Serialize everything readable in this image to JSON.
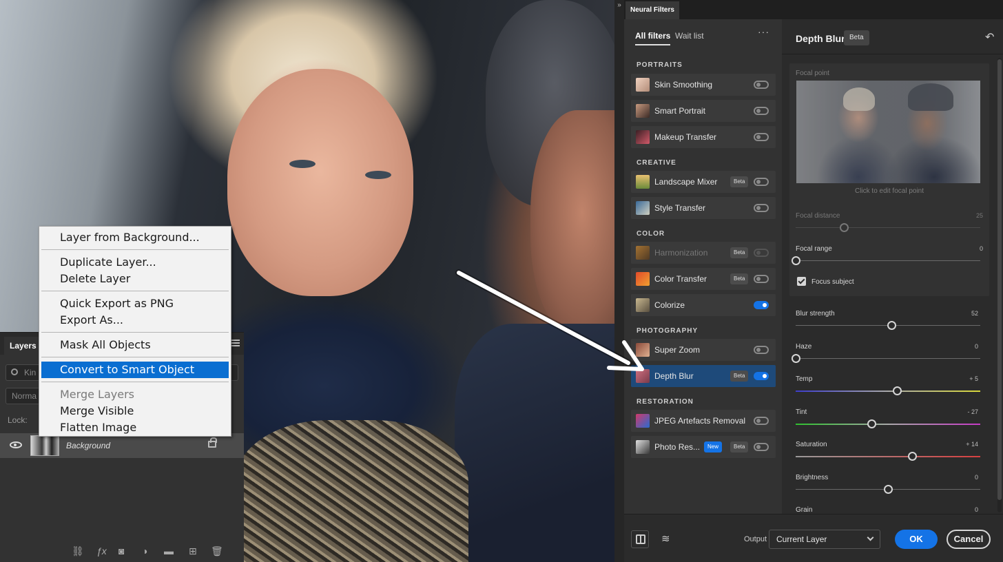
{
  "layers_panel": {
    "tab": "Layers",
    "search_placeholder": "Kin",
    "blend_mode": "Norma",
    "lock_label": "Lock:",
    "layer_name": "Background"
  },
  "context_menu": {
    "items": [
      {
        "label": "Layer from Background..."
      },
      {
        "label": "Duplicate Layer..."
      },
      {
        "label": "Delete Layer"
      },
      {
        "label": "Quick Export as PNG"
      },
      {
        "label": "Export As..."
      },
      {
        "label": "Mask All Objects"
      },
      {
        "label": "Convert to Smart Object",
        "selected": true
      },
      {
        "label": "Merge Layers",
        "disabled": true
      },
      {
        "label": "Merge Visible"
      },
      {
        "label": "Flatten Image"
      }
    ]
  },
  "neural_filters": {
    "dialog_tab": "Neural Filters",
    "list_tabs": {
      "all": "All filters",
      "wait": "Wait list"
    },
    "more": "···",
    "categories": [
      "PORTRAITS",
      "CREATIVE",
      "COLOR",
      "PHOTOGRAPHY",
      "RESTORATION"
    ],
    "filters": [
      {
        "name": "Skin Smoothing",
        "on": false
      },
      {
        "name": "Smart Portrait",
        "on": false
      },
      {
        "name": "Makeup Transfer",
        "on": false
      },
      {
        "name": "Landscape Mixer",
        "badge": "Beta",
        "on": false
      },
      {
        "name": "Style Transfer",
        "on": false
      },
      {
        "name": "Harmonization",
        "badge": "Beta",
        "on": false,
        "disabled": true
      },
      {
        "name": "Color Transfer",
        "badge": "Beta",
        "on": false
      },
      {
        "name": "Colorize",
        "on": true
      },
      {
        "name": "Super Zoom",
        "on": false
      },
      {
        "name": "Depth Blur",
        "badge": "Beta",
        "on": true,
        "active": true
      },
      {
        "name": "JPEG Artefacts Removal",
        "on": false
      },
      {
        "name": "Photo Res...",
        "badge_new": "New",
        "badge": "Beta",
        "on": false
      }
    ],
    "detail": {
      "title": "Depth Blur",
      "badge": "Beta",
      "focal_point_label": "Focal point",
      "preview_caption": "Click to edit focal point",
      "focal_distance": {
        "label": "Focal distance",
        "value": "25",
        "level": 0.26
      },
      "focal_range": {
        "label": "Focal range",
        "value": "0",
        "level": 0.0
      },
      "focus_subject": "Focus subject",
      "sliders": [
        {
          "label": "Blur strength",
          "value": "52",
          "level": 0.52,
          "kind": "plain"
        },
        {
          "label": "Haze",
          "value": "0",
          "level": 0.0,
          "kind": "plain"
        },
        {
          "label": "Temp",
          "value": "+ 5",
          "level": 0.55,
          "kind": "temp"
        },
        {
          "label": "Tint",
          "value": "- 27",
          "level": 0.41,
          "kind": "tint"
        },
        {
          "label": "Saturation",
          "value": "+ 14",
          "level": 0.63,
          "kind": "sat"
        },
        {
          "label": "Brightness",
          "value": "0",
          "level": 0.5,
          "kind": "plain"
        },
        {
          "label": "Grain",
          "value": "0",
          "level": 0.0,
          "kind": "plain"
        }
      ]
    },
    "footer": {
      "output_label": "Output",
      "output_value": "Current Layer",
      "ok": "OK",
      "cancel": "Cancel"
    }
  }
}
